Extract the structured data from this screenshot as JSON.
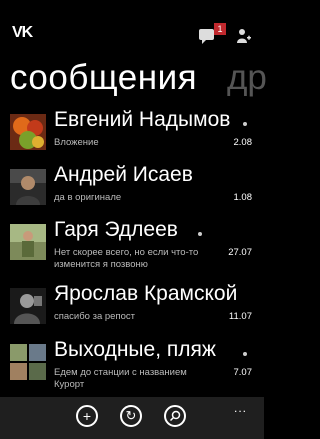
{
  "header": {
    "logo": "VK",
    "notification_count": "1",
    "title": "сообщения",
    "next_title": "др"
  },
  "messages": [
    {
      "name": "Евгений Надымов",
      "preview": "Вложение",
      "date": "2.08",
      "unread": true
    },
    {
      "name": "Андрей Исаев",
      "preview": "да в оригинале",
      "date": "1.08",
      "unread": false
    },
    {
      "name": "Гаря Эдлеев",
      "preview": "Нет скорее всего, но если что-то изменится я позвоню",
      "date": "27.07",
      "unread": true
    },
    {
      "name": "Ярослав Крамской",
      "preview": "спасибо за репост",
      "date": "11.07",
      "unread": false
    },
    {
      "name": "Выходные, пляж",
      "preview": "Едем до станции с названием Курорт",
      "date": "7.07",
      "unread": true
    }
  ],
  "appbar": {
    "buttons": [
      "add-icon",
      "refresh-icon",
      "search-icon"
    ],
    "more": "..."
  }
}
